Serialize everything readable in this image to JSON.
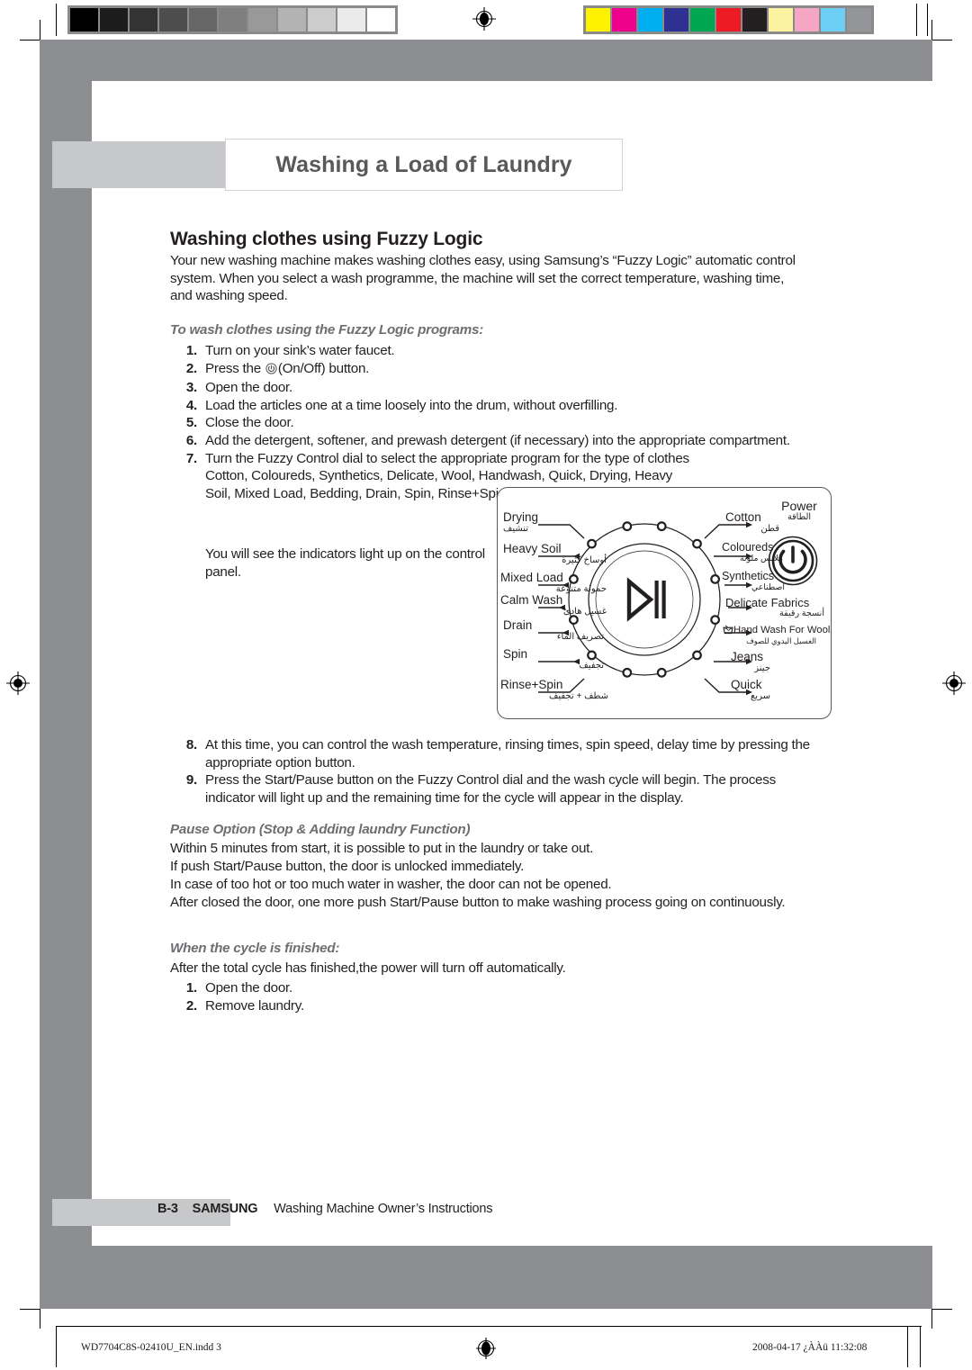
{
  "page": {
    "title": "Washing a Load of Laundry",
    "section_heading": "Washing clothes using Fuzzy Logic",
    "intro": "Your new washing machine makes washing clothes easy, using Samsung’s “Fuzzy Logic” automatic control system. When you select a wash programme, the machine will set the correct temperature, washing time, and washing speed.",
    "subhead_steps": "To wash clothes using the Fuzzy Logic programs:",
    "steps": [
      {
        "num": "1.",
        "text": "Turn on your sink’s water faucet."
      },
      {
        "num": "2.",
        "text_before": "Press the",
        "icon": "power-on-off-icon",
        "text_after": "(On/Off) button."
      },
      {
        "num": "3.",
        "text": "Open the door."
      },
      {
        "num": "4.",
        "text": "Load the articles one at a time loosely into the drum, without overfilling."
      },
      {
        "num": "5.",
        "text": "Close the door."
      },
      {
        "num": "6.",
        "text": "Add the detergent, softener, and prewash detergent (if necessary) into the appropriate compartment."
      },
      {
        "num": "7.",
        "text": "Turn the Fuzzy Control dial to select the appropriate program for the type of clothes Cotton, Coloureds, Synthetics, Delicate, Wool, Handwash, Quick, Drying, Heavy Soil, Mixed Load, Bedding, Drain, Spin, Rinse+Spin."
      }
    ],
    "indicator_note": "You will see the indicators light up on the control panel.",
    "steps2": [
      {
        "num": "8.",
        "text": "At this time, you can control the wash temperature, rinsing times, spin speed, delay time by pressing the appropriate option button."
      },
      {
        "num": "9.",
        "text": "Press the Start/Pause button on the Fuzzy Control dial and the wash cycle will begin. The process indicator will light up and the remaining time for the cycle will appear in the display."
      }
    ],
    "pause_option": {
      "heading": "Pause Option (Stop & Adding laundry Function)",
      "lines": [
        "Within 5 minutes from start, it is possible to put in the laundry or take out.",
        "If push Start/Pause button, the door is unlocked immediately.",
        "In case of too hot or too much water in washer, the door can not be opened.",
        "After closed the door, one more push Start/Pause button to make washing process going on continuously."
      ]
    },
    "cycle_finished": {
      "heading": "When the cycle is finished:",
      "intro": "After the total cycle has finished,the power will turn off automatically.",
      "steps": [
        {
          "num": "1.",
          "text": "Open the door."
        },
        {
          "num": "2.",
          "text": "Remove laundry."
        }
      ]
    }
  },
  "dial": {
    "play_pause_icon": "play-pause-icon",
    "power": {
      "label_en": "Power",
      "label_ar": "الطاقة",
      "icon": "power-icon"
    },
    "labels_left": [
      {
        "en": "Drying",
        "ar": "تنشيف"
      },
      {
        "en": "Heavy Soil",
        "ar": "أوساخ كثيرة"
      },
      {
        "en": "Mixed Load",
        "ar": "حمولة متنوعة"
      },
      {
        "en": "Calm Wash",
        "ar": "غسيل هادئ"
      },
      {
        "en": "Drain",
        "ar": "تصريف الماء"
      },
      {
        "en": "Spin",
        "ar": "تجفيف"
      },
      {
        "en": "Rinse+Spin",
        "ar": "شطف + تجفيف"
      }
    ],
    "labels_right": [
      {
        "en": "Cotton",
        "ar": "قطن"
      },
      {
        "en": "Coloureds",
        "ar": "ملابس ملونة"
      },
      {
        "en": "Synthetics",
        "ar": "اصطناعي"
      },
      {
        "en": "Delicate Fabrics",
        "ar": "أنسجة رقيقة"
      },
      {
        "en": "Hand Wash For Wool",
        "ar": "الغسيل اليدوي للصوف",
        "icon": "hand-wash-icon"
      },
      {
        "en": "Jeans",
        "ar": "جينز"
      },
      {
        "en": "Quick",
        "ar": "سريع"
      }
    ]
  },
  "footer": {
    "page_number": "B-3",
    "brand": "SAMSUNG",
    "doc_title": "Washing Machine Owner’s Instructions"
  },
  "print_footer": {
    "filename": "WD7704C8S-02410U_EN.indd   3",
    "timestamp": "2008-04-17   ¿ÀÀü 11:32:08",
    "registration_icon": "registration-target-icon"
  },
  "calibration": {
    "greyscale": [
      "#000000",
      "#1c1c1c",
      "#333333",
      "#4d4d4d",
      "#666666",
      "#7f7f7f",
      "#999999",
      "#b3b3b3",
      "#cccccc",
      "#ebebeb",
      "#ffffff"
    ],
    "colors": [
      "#fff200",
      "#ec008c",
      "#00aeef",
      "#2e3192",
      "#00a651",
      "#ed1c24",
      "#231f20",
      "#fbf3a0",
      "#f4a6c4",
      "#6dcff6",
      "#939598"
    ]
  },
  "theme": {
    "band_dark": "#8c8e91",
    "band_light": "#c6c8ca",
    "title_grey": "#58595b",
    "ink": "#231f20"
  }
}
